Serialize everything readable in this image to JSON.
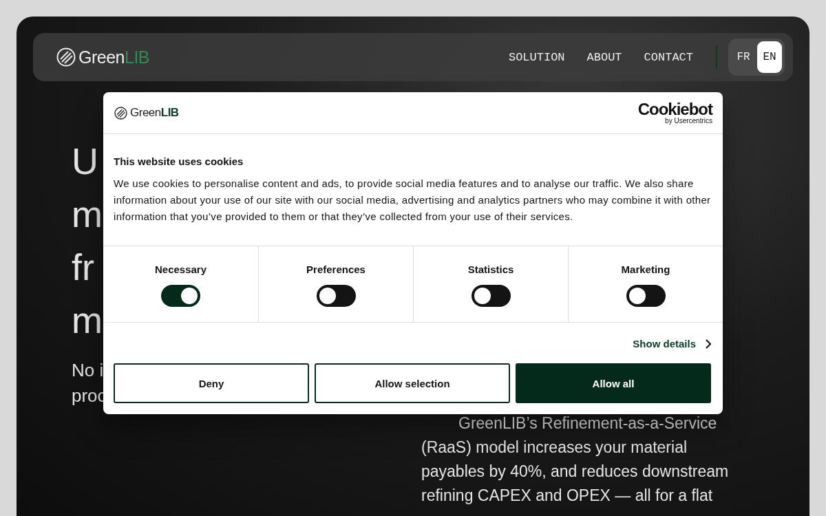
{
  "nav": {
    "logo": {
      "text": "Green",
      "accent": "LIB"
    },
    "links": [
      "SOLUTION",
      "ABOUT",
      "CONTACT"
    ],
    "languages": [
      {
        "label": "FR",
        "selected": false
      },
      {
        "label": "EN",
        "selected": true
      }
    ]
  },
  "hero": {
    "heading_fragments": [
      "U",
      "m",
      "fr",
      "m"
    ],
    "subtitle_fragments": [
      "No i",
      "proc"
    ],
    "paragraph_lines": [
      "GreenLIB’s Refinement-as-a-Service",
      "(RaaS) model increases your material",
      "payables by 40%, and reduces downstream",
      "refining CAPEX and OPEX — all for a flat"
    ]
  },
  "cookie_dialog": {
    "logo": {
      "text": "Green",
      "accent": "LIB"
    },
    "provider": {
      "name": "Cookiebot",
      "byline": "by Usercentrics"
    },
    "title": "This website uses cookies",
    "text": "We use cookies to personalise content and ads, to provide social media features and to analyse our traffic. We also share information about your use of our site with our social media, advertising and analytics partners who may combine it with other information that you’ve provided to them or that they’ve collected from your use of their services.",
    "categories": [
      {
        "label": "Necessary",
        "checked": true
      },
      {
        "label": "Preferences",
        "checked": false
      },
      {
        "label": "Statistics",
        "checked": false
      },
      {
        "label": "Marketing",
        "checked": false
      }
    ],
    "show_details": "Show details",
    "buttons": [
      {
        "label": "Deny",
        "kind": "outline"
      },
      {
        "label": "Allow selection",
        "kind": "outline"
      },
      {
        "label": "Allow all",
        "kind": "primary"
      }
    ]
  }
}
